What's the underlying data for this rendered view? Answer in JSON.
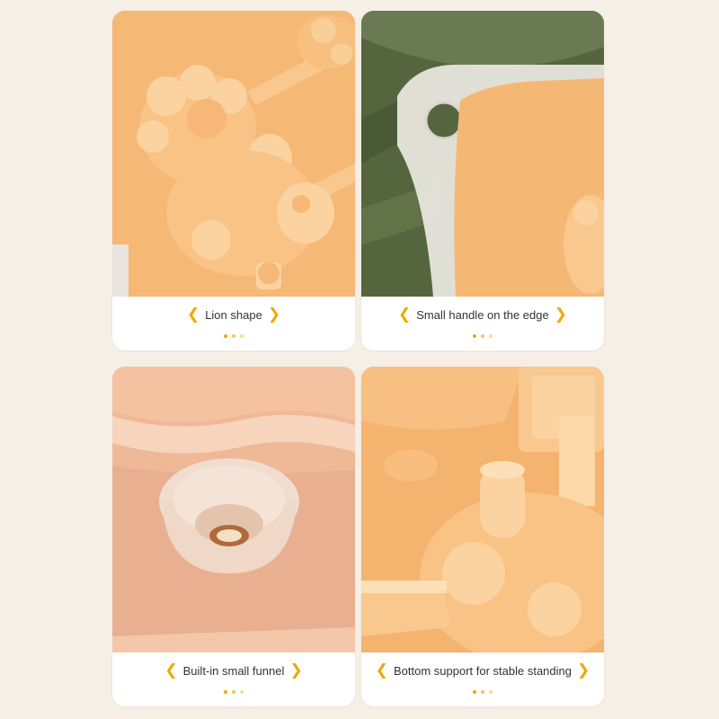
{
  "panels": [
    {
      "caption": "Lion shape",
      "left_chevron": "❮",
      "right_chevron": "❯"
    },
    {
      "caption": "Small handle on the edge",
      "left_chevron": "❮",
      "right_chevron": "❯"
    },
    {
      "caption": "Built-in small funnel",
      "left_chevron": "❮",
      "right_chevron": "❯"
    },
    {
      "caption": "Bottom support for stable standing",
      "left_chevron": "❮",
      "right_chevron": "❯"
    }
  ],
  "colors": {
    "accent": "#f0a800",
    "mold_orange": "#f5b874",
    "mold_light": "#f8c48a",
    "leaf_green": "#5a6b45",
    "background": "#f5efe6"
  }
}
